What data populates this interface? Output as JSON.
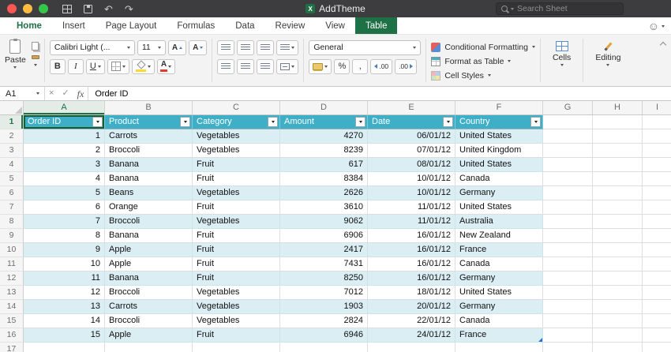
{
  "colors": {
    "accent_green": "#1e7145",
    "table_header_teal": "#3fafc8",
    "table_band_blue": "#daeef3",
    "titlebar_gray": "#3d3d40"
  },
  "titlebar": {
    "title": "AddTheme",
    "app_icon_letter": "X",
    "search_placeholder": "Search Sheet"
  },
  "tabs": [
    {
      "label": "Home",
      "state": "active"
    },
    {
      "label": "Insert",
      "state": "normal"
    },
    {
      "label": "Page Layout",
      "state": "normal"
    },
    {
      "label": "Formulas",
      "state": "normal"
    },
    {
      "label": "Data",
      "state": "normal"
    },
    {
      "label": "Review",
      "state": "normal"
    },
    {
      "label": "View",
      "state": "normal"
    },
    {
      "label": "Table",
      "state": "contextual"
    }
  ],
  "ribbon": {
    "paste": "Paste",
    "font_name": "Calibri Light (...",
    "font_size": "11",
    "font_grow": "A",
    "font_shrink": "A",
    "bold": "B",
    "italic": "I",
    "underline": "U",
    "font_color_label": "A",
    "number_format": "General",
    "percent": "%",
    "comma": ",",
    "decimal": ".00",
    "conditional_formatting": "Conditional Formatting",
    "format_as_table": "Format as Table",
    "cell_styles": "Cell Styles",
    "cells": "Cells",
    "editing": "Editing"
  },
  "glyphs": {
    "smiley": "☺",
    "undo": "↶",
    "redo": "↷",
    "cancel": "×",
    "enter": "✓"
  },
  "formula_bar": {
    "name_box": "A1",
    "fx": "fx",
    "content": "Order ID"
  },
  "grid": {
    "column_letters": [
      "A",
      "B",
      "C",
      "D",
      "E",
      "F",
      "G",
      "H",
      "I"
    ],
    "visible_rows": 17,
    "selected_cell": "A1"
  },
  "table": {
    "headers": [
      "Order ID",
      "Product",
      "Category",
      "Amount",
      "Date",
      "Country"
    ],
    "rows": [
      [
        "1",
        "Carrots",
        "Vegetables",
        "4270",
        "06/01/12",
        "United States"
      ],
      [
        "2",
        "Broccoli",
        "Vegetables",
        "8239",
        "07/01/12",
        "United Kingdom"
      ],
      [
        "3",
        "Banana",
        "Fruit",
        "617",
        "08/01/12",
        "United States"
      ],
      [
        "4",
        "Banana",
        "Fruit",
        "8384",
        "10/01/12",
        "Canada"
      ],
      [
        "5",
        "Beans",
        "Vegetables",
        "2626",
        "10/01/12",
        "Germany"
      ],
      [
        "6",
        "Orange",
        "Fruit",
        "3610",
        "11/01/12",
        "United States"
      ],
      [
        "7",
        "Broccoli",
        "Vegetables",
        "9062",
        "11/01/12",
        "Australia"
      ],
      [
        "8",
        "Banana",
        "Fruit",
        "6906",
        "16/01/12",
        "New Zealand"
      ],
      [
        "9",
        "Apple",
        "Fruit",
        "2417",
        "16/01/12",
        "France"
      ],
      [
        "10",
        "Apple",
        "Fruit",
        "7431",
        "16/01/12",
        "Canada"
      ],
      [
        "11",
        "Banana",
        "Fruit",
        "8250",
        "16/01/12",
        "Germany"
      ],
      [
        "12",
        "Broccoli",
        "Vegetables",
        "7012",
        "18/01/12",
        "United States"
      ],
      [
        "13",
        "Carrots",
        "Vegetables",
        "1903",
        "20/01/12",
        "Germany"
      ],
      [
        "14",
        "Broccoli",
        "Vegetables",
        "2824",
        "22/01/12",
        "Canada"
      ],
      [
        "15",
        "Apple",
        "Fruit",
        "6946",
        "24/01/12",
        "France"
      ]
    ]
  }
}
